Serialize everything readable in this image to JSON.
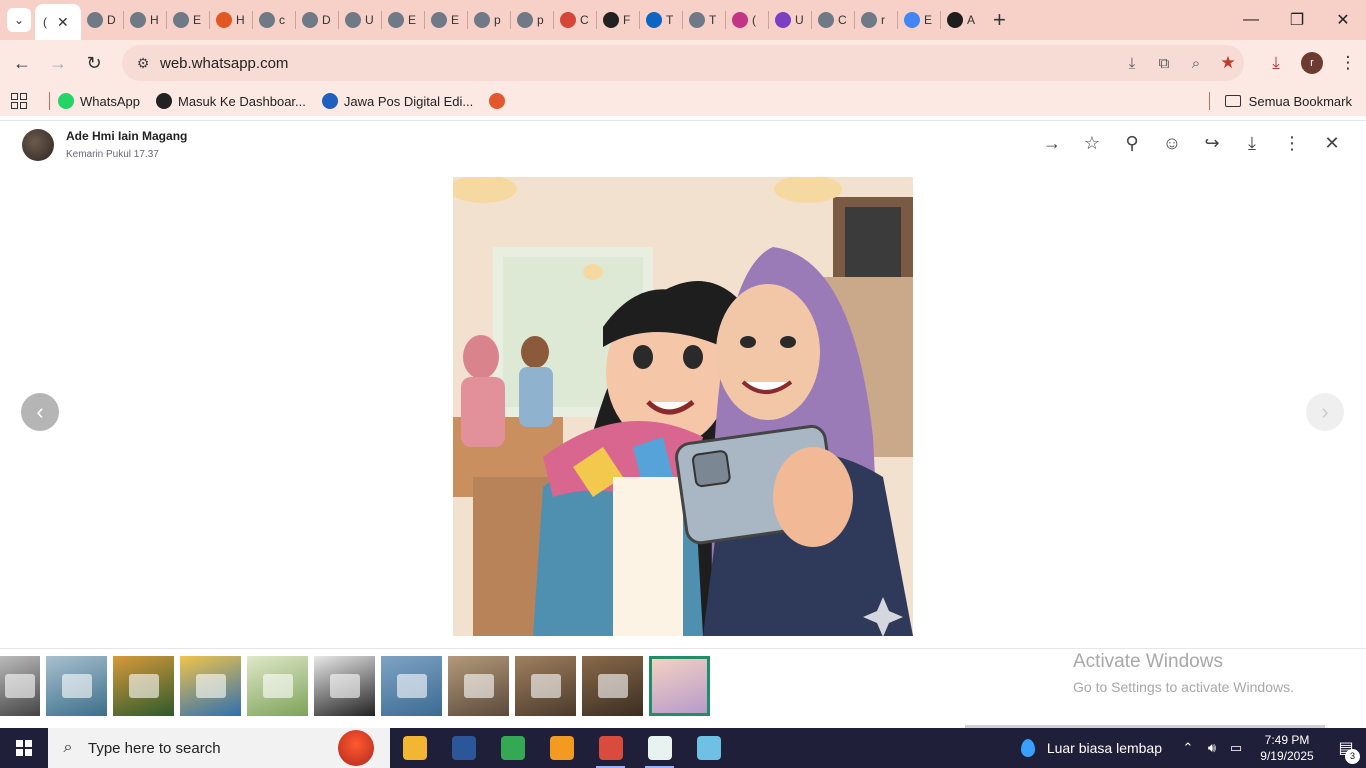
{
  "browser": {
    "tabs": [
      {
        "title": "(",
        "fav": "#cfcfcf",
        "active": true
      },
      {
        "title": "D",
        "fav": "#6f7a86"
      },
      {
        "title": "H",
        "fav": "#6f7a86"
      },
      {
        "title": "E",
        "fav": "#6f7a86"
      },
      {
        "title": "H",
        "fav": "#e25822"
      },
      {
        "title": "c",
        "fav": "#6f7a86"
      },
      {
        "title": "D",
        "fav": "#6f7a86"
      },
      {
        "title": "U",
        "fav": "#6f7a86"
      },
      {
        "title": "E",
        "fav": "#6f7a86"
      },
      {
        "title": "E",
        "fav": "#6f7a86"
      },
      {
        "title": "p",
        "fav": "#6f7a86"
      },
      {
        "title": "p",
        "fav": "#6f7a86"
      },
      {
        "title": "C",
        "fav": "#d44638"
      },
      {
        "title": "F",
        "fav": "#222222"
      },
      {
        "title": "T",
        "fav": "#0a66c2"
      },
      {
        "title": "T",
        "fav": "#6f7a86"
      },
      {
        "title": "(",
        "fav": "#c13584"
      },
      {
        "title": "U",
        "fav": "#7a3fc2"
      },
      {
        "title": "C",
        "fav": "#6f7a86"
      },
      {
        "title": "r",
        "fav": "#6f7a86"
      },
      {
        "title": "E",
        "fav": "#4285f4"
      },
      {
        "title": "A",
        "fav": "#1e1e1e"
      }
    ],
    "new_tab": "+",
    "window": {
      "minimize": "—",
      "restore": "❐",
      "close": "✕"
    },
    "url": "web.whatsapp.com",
    "bookmarks": [
      {
        "label": "WhatsApp",
        "color": "#25d366"
      },
      {
        "label": "Masuk Ke Dashboar...",
        "color": "#222222"
      },
      {
        "label": "Jawa Pos Digital Edi...",
        "color": "#1f5fbf"
      },
      {
        "label": "",
        "color": "#e4572e"
      }
    ],
    "all_bookmarks": "Semua Bookmark",
    "profile_letter": "r"
  },
  "viewer": {
    "sender": "Ade Hmi Iain Magang",
    "time": "Kemarin Pukul 17.37",
    "actions": [
      {
        "name": "go-to-message-icon",
        "glyph": "→"
      },
      {
        "name": "star-icon",
        "glyph": "☆"
      },
      {
        "name": "pin-icon",
        "glyph": "⚲"
      },
      {
        "name": "react-emoji-icon",
        "glyph": "☺"
      },
      {
        "name": "forward-icon",
        "glyph": "↪"
      },
      {
        "name": "download-icon",
        "glyph": "⤓"
      },
      {
        "name": "more-options-icon",
        "glyph": "⋮"
      },
      {
        "name": "close-viewer-icon",
        "glyph": "✕"
      }
    ],
    "thumbnails": [
      {
        "colors": [
          "#444",
          "#bbb"
        ],
        "selected": false
      },
      {
        "colors": [
          "#3b6f8a",
          "#a9c0cf"
        ],
        "selected": false
      },
      {
        "colors": [
          "#2c5a2d",
          "#d89a3a"
        ],
        "selected": false
      },
      {
        "colors": [
          "#2f6fb0",
          "#f0c44a"
        ],
        "selected": false
      },
      {
        "colors": [
          "#7ea35a",
          "#dfe8c8"
        ],
        "selected": false
      },
      {
        "colors": [
          "#222",
          "#e8e8e8"
        ],
        "selected": false
      },
      {
        "colors": [
          "#3b6b92",
          "#7fa3c4"
        ],
        "selected": false
      },
      {
        "colors": [
          "#5a4a3a",
          "#b59a7a"
        ],
        "selected": false
      },
      {
        "colors": [
          "#4a3a2a",
          "#a08060"
        ],
        "selected": false
      },
      {
        "colors": [
          "#3a2e22",
          "#8a6a4a"
        ],
        "selected": false
      },
      {
        "colors": [
          "#b89acb",
          "#f2d2c2"
        ],
        "selected": true
      }
    ]
  },
  "watermark": {
    "line1": "Activate Windows",
    "line2": "Go to Settings to activate Windows."
  },
  "taskbar": {
    "search_placeholder": "Type here to search",
    "apps": [
      {
        "name": "file-explorer-icon",
        "color": "#f2b632"
      },
      {
        "name": "word-icon",
        "color": "#2b579a"
      },
      {
        "name": "chrome-icon",
        "color": "#34a853"
      },
      {
        "name": "vpn-app-icon",
        "color": "#f29b20"
      },
      {
        "name": "chrome-profile-icon",
        "color": "#d94c3d",
        "active": true
      },
      {
        "name": "notepad-icon",
        "color": "#e8f3ef",
        "active": true
      },
      {
        "name": "paint-icon",
        "color": "#6ec1e4"
      }
    ],
    "weather": "Luar biasa lembap",
    "time": "7:49 PM",
    "date": "9/19/2025",
    "notifications": "3"
  }
}
